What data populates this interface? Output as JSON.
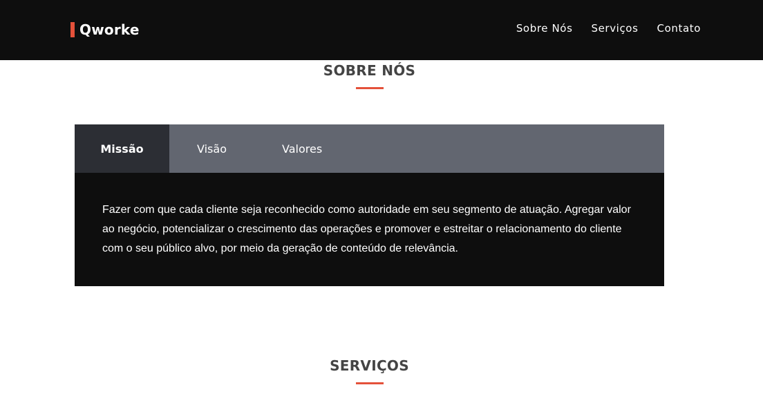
{
  "header": {
    "brand": "Qworke",
    "nav": [
      "Sobre Nós",
      "Serviços",
      "Contato"
    ]
  },
  "about": {
    "title": "SOBRE NÓS",
    "tabs": [
      "Missão",
      "Visão",
      "Valores"
    ],
    "active_tab": "Missão",
    "content": "Fazer com que cada cliente seja reconhecido como autoridade em seu segmento de atuação. Agregar valor ao negócio, potencializar o crescimento das operações e promover e estreitar o relacionamento do cliente com o seu público alvo, por meio da geração de conteúdo de relevância."
  },
  "services": {
    "title": "SERVIÇOS"
  },
  "colors": {
    "accent": "#e4513a",
    "header_bg": "#0e0e0e",
    "tab_bar_bg": "#626670",
    "tab_active_bg": "#2c2e34",
    "title_text": "#444444"
  }
}
